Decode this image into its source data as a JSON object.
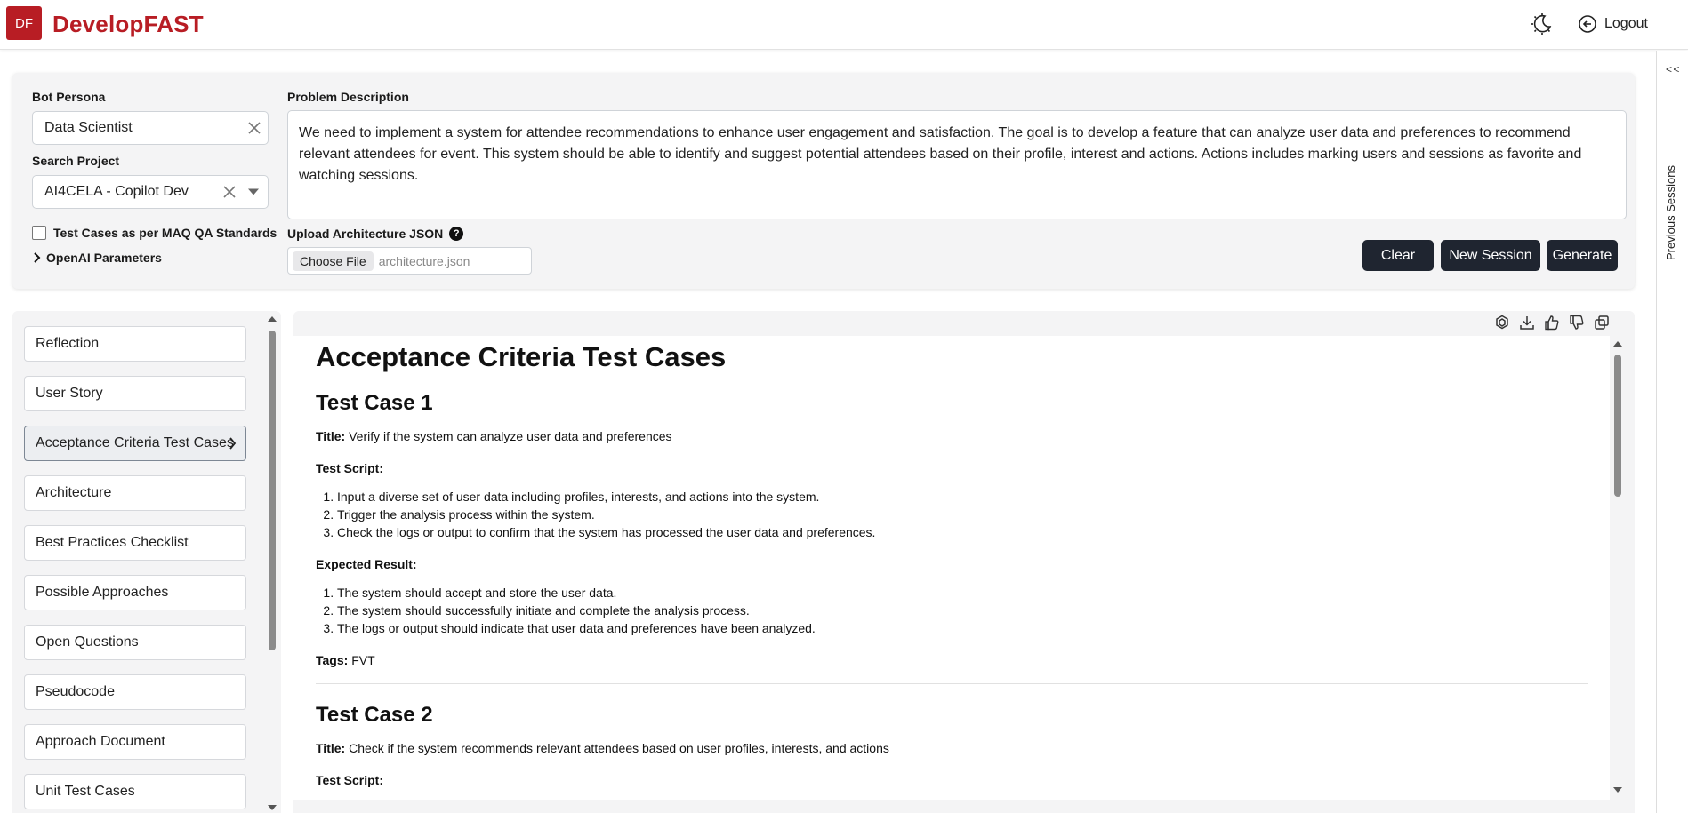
{
  "header": {
    "logo_badge": "DF",
    "brand": "DevelopFAST",
    "logout_label": "Logout",
    "theme_icon": "moon-sun-icon",
    "logout_icon": "logout-icon",
    "brand_color": "#b81d24"
  },
  "rail": {
    "toggle": "< <",
    "label": "Previous Sessions"
  },
  "form": {
    "persona_label": "Bot Persona",
    "persona_value": "Data Scientist",
    "project_label": "Search Project",
    "project_value": "AI4CELA - Copilot Dev",
    "maq_checkbox_label": "Test Cases as per MAQ QA Standards",
    "openai_label": "OpenAI Parameters",
    "problem_label": "Problem Description",
    "problem_text": "We need to implement a system for attendee recommendations to enhance user engagement and satisfaction. The goal is to develop a feature that can analyze user data and preferences to recommend relevant attendees for event. This system should be able to identify and suggest potential attendees based on their profile, interest and actions. Actions includes marking users and sessions as favorite and watching sessions.",
    "upload_label": "Upload Architecture JSON",
    "help_glyph": "?",
    "choose_file_label": "Choose File",
    "file_name": "architecture.json",
    "clear_label": "Clear",
    "new_session_label": "New Session",
    "generate_label": "Generate",
    "button_color": "#1f2530"
  },
  "nav": {
    "items": [
      "Reflection",
      "User Story",
      "Acceptance Criteria Test Cases",
      "Architecture",
      "Best Practices Checklist",
      "Possible Approaches",
      "Open Questions",
      "Pseudocode",
      "Approach Document",
      "Unit Test Cases"
    ],
    "active": "Acceptance Criteria Test Cases"
  },
  "toolbar": {
    "icons": [
      "openai-icon",
      "download-icon",
      "thumbs-up-icon",
      "thumbs-down-icon",
      "copy-icon"
    ]
  },
  "doc": {
    "title": "Acceptance Criteria Test Cases",
    "tc1": {
      "heading": "Test Case 1",
      "title_label": "Title:",
      "title_value": "Verify if the system can analyze user data and preferences",
      "script_label": "Test Script:",
      "script": [
        "Input a diverse set of user data including profiles, interests, and actions into the system.",
        "Trigger the analysis process within the system.",
        "Check the logs or output to confirm that the system has processed the user data and preferences."
      ],
      "expected_label": "Expected Result:",
      "expected": [
        "The system should accept and store the user data.",
        "The system should successfully initiate and complete the analysis process.",
        "The logs or output should indicate that user data and preferences have been analyzed."
      ],
      "tags_label": "Tags:",
      "tags_value": "FVT"
    },
    "tc2": {
      "heading": "Test Case 2",
      "title_label": "Title:",
      "title_value": "Check if the system recommends relevant attendees based on user profiles, interests, and actions",
      "script_label": "Test Script:"
    }
  }
}
